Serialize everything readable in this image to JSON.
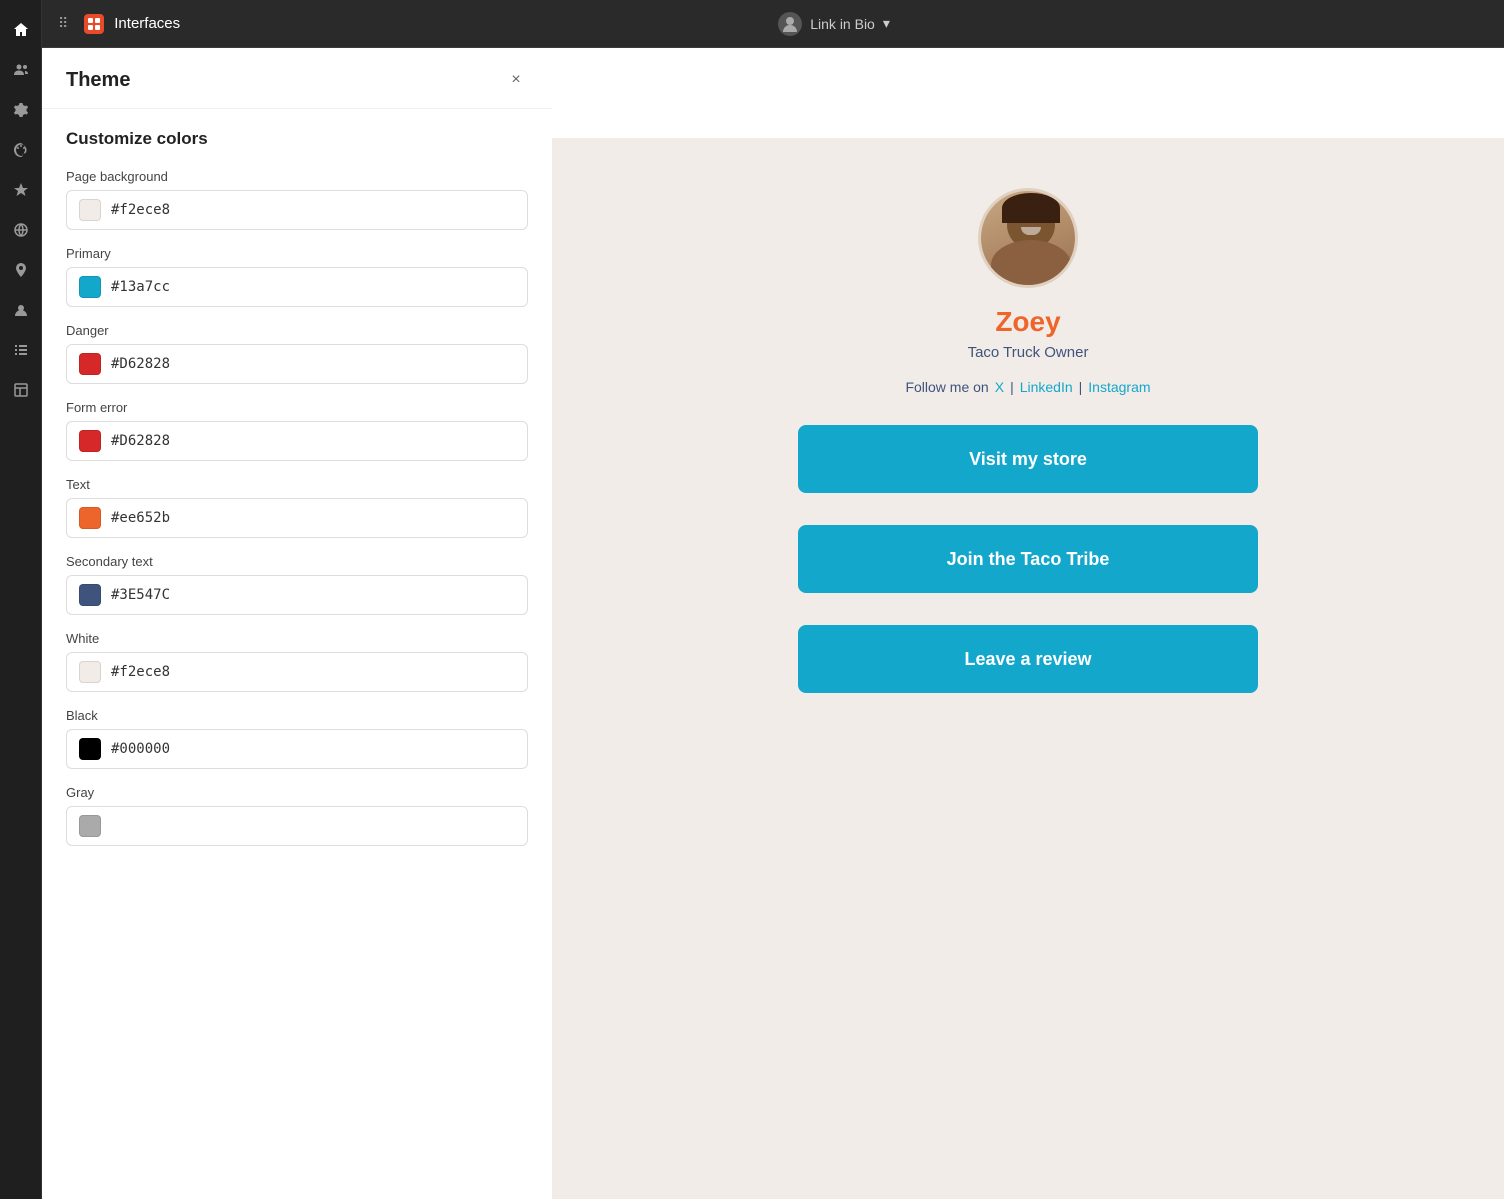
{
  "app": {
    "title": "Interfaces",
    "logo_text": "I"
  },
  "topbar": {
    "grid_icon": "⊞",
    "link_in_bio_label": "Link in Bio",
    "dropdown_icon": "▾",
    "avatar_text": "👤"
  },
  "nav": {
    "icons": [
      {
        "name": "home",
        "symbol": "⌂"
      },
      {
        "name": "people",
        "symbol": "⬤"
      },
      {
        "name": "settings",
        "symbol": "⚙"
      },
      {
        "name": "palette",
        "symbol": "🎨"
      },
      {
        "name": "star",
        "symbol": "☆"
      },
      {
        "name": "globe",
        "symbol": "○"
      },
      {
        "name": "location",
        "symbol": "◎"
      },
      {
        "name": "contacts",
        "symbol": "👥"
      },
      {
        "name": "list",
        "symbol": "☰"
      },
      {
        "name": "layout",
        "symbol": "▭"
      }
    ]
  },
  "theme_panel": {
    "title": "Theme",
    "close_label": "×",
    "section_title": "Customize colors",
    "fields": [
      {
        "label": "Page background",
        "value": "#f2ece8",
        "color": "#f2ece8",
        "swatch_border": "#ddd"
      },
      {
        "label": "Primary",
        "value": "#13a7cc",
        "color": "#13a7cc",
        "swatch_border": "#0f8fab"
      },
      {
        "label": "Danger",
        "value": "#D62828",
        "color": "#D62828",
        "swatch_border": "#b52020"
      },
      {
        "label": "Form error",
        "value": "#D62828",
        "color": "#D62828",
        "swatch_border": "#b52020"
      },
      {
        "label": "Text",
        "value": "#ee652b",
        "color": "#ee652b",
        "swatch_border": "#cc5520"
      },
      {
        "label": "Secondary text",
        "value": "#3E547C",
        "color": "#3E547C",
        "swatch_border": "#2d3e5c"
      },
      {
        "label": "White",
        "value": "#f2ece8",
        "color": "#f2ece8",
        "swatch_border": "#ddd"
      },
      {
        "label": "Black",
        "value": "#000000",
        "color": "#000000",
        "swatch_border": "#333"
      },
      {
        "label": "Gray",
        "value": "",
        "color": "#aaa",
        "swatch_border": "#999"
      }
    ]
  },
  "profile": {
    "name": "Zoey",
    "subtitle": "Taco Truck Owner",
    "follow_text": "Follow me on",
    "social_links": [
      {
        "label": "X",
        "separator": "|"
      },
      {
        "label": "LinkedIn",
        "separator": "|"
      },
      {
        "label": "Instagram",
        "separator": ""
      }
    ]
  },
  "buttons": [
    {
      "label": "Visit my store"
    },
    {
      "label": "Join the Taco Tribe"
    },
    {
      "label": "Leave a review"
    }
  ],
  "colors": {
    "primary": "#13a7cc",
    "text_color": "#ee652b",
    "secondary_text": "#3E547C",
    "page_bg": "#f2ece8",
    "danger": "#D62828"
  }
}
